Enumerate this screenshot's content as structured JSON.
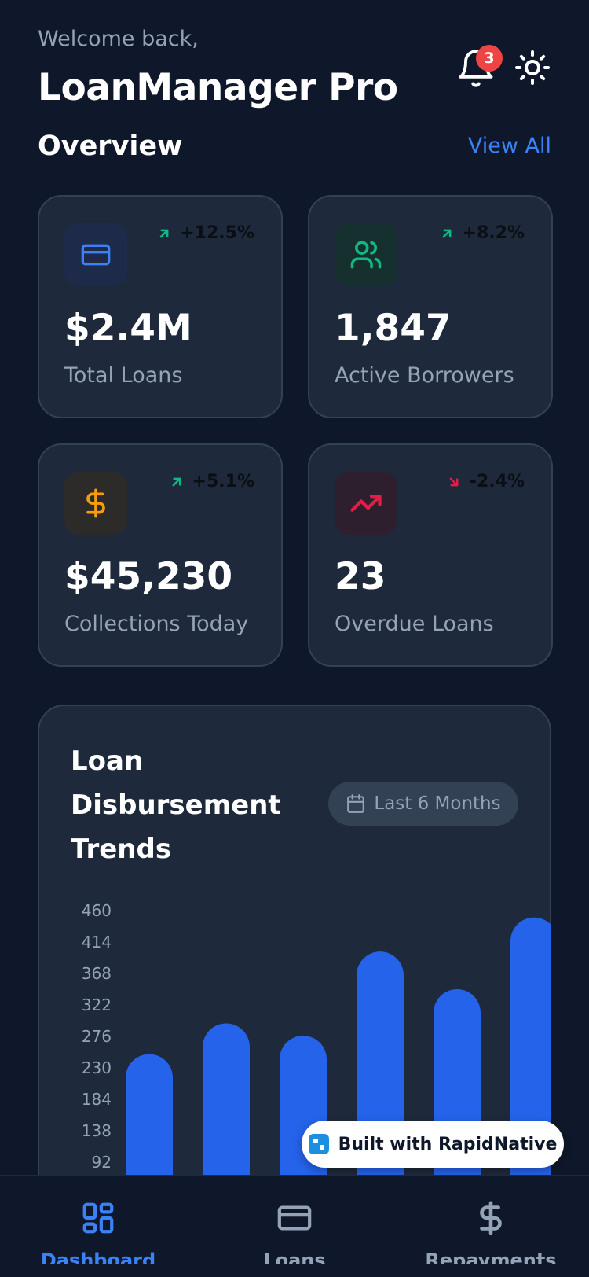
{
  "header": {
    "welcome": "Welcome back,",
    "title": "LoanManager Pro",
    "notification_count": "3"
  },
  "overview": {
    "title": "Overview",
    "view_all": "View All"
  },
  "stats": [
    {
      "icon": "credit-card-icon",
      "change": "+12.5%",
      "trend": "up",
      "value": "$2.4M",
      "label": "Total Loans"
    },
    {
      "icon": "users-icon",
      "change": "+8.2%",
      "trend": "up",
      "value": "1,847",
      "label": "Active Borrowers"
    },
    {
      "icon": "dollar-icon",
      "change": "+5.1%",
      "trend": "up",
      "value": "$45,230",
      "label": "Collections Today"
    },
    {
      "icon": "trending-up-icon",
      "change": "-2.4%",
      "trend": "down",
      "value": "23",
      "label": "Overdue Loans"
    }
  ],
  "chart": {
    "title": "Loan Disbursement Trends",
    "range": "Last 6 Months"
  },
  "chart_data": {
    "type": "bar",
    "title": "Loan Disbursement Trends",
    "categories": [],
    "values": [
      250,
      295,
      277,
      400,
      345,
      450
    ],
    "yticks": [
      460,
      414,
      368,
      322,
      276,
      230,
      184,
      138,
      92
    ],
    "ylim": [
      0,
      460
    ],
    "grid": false,
    "color": "#2563eb"
  },
  "colors": {
    "accent": "#3b82f6",
    "up": "#10b981",
    "down": "#e11d48",
    "card": "#1e293b",
    "background": "#0f172a"
  },
  "built_badge": "Built with RapidNative",
  "tabs": [
    {
      "label": "Dashboard",
      "icon": "dashboard-icon",
      "active": true
    },
    {
      "label": "Loans",
      "icon": "credit-card-icon",
      "active": false
    },
    {
      "label": "Repayments",
      "icon": "dollar-icon",
      "active": false
    }
  ]
}
